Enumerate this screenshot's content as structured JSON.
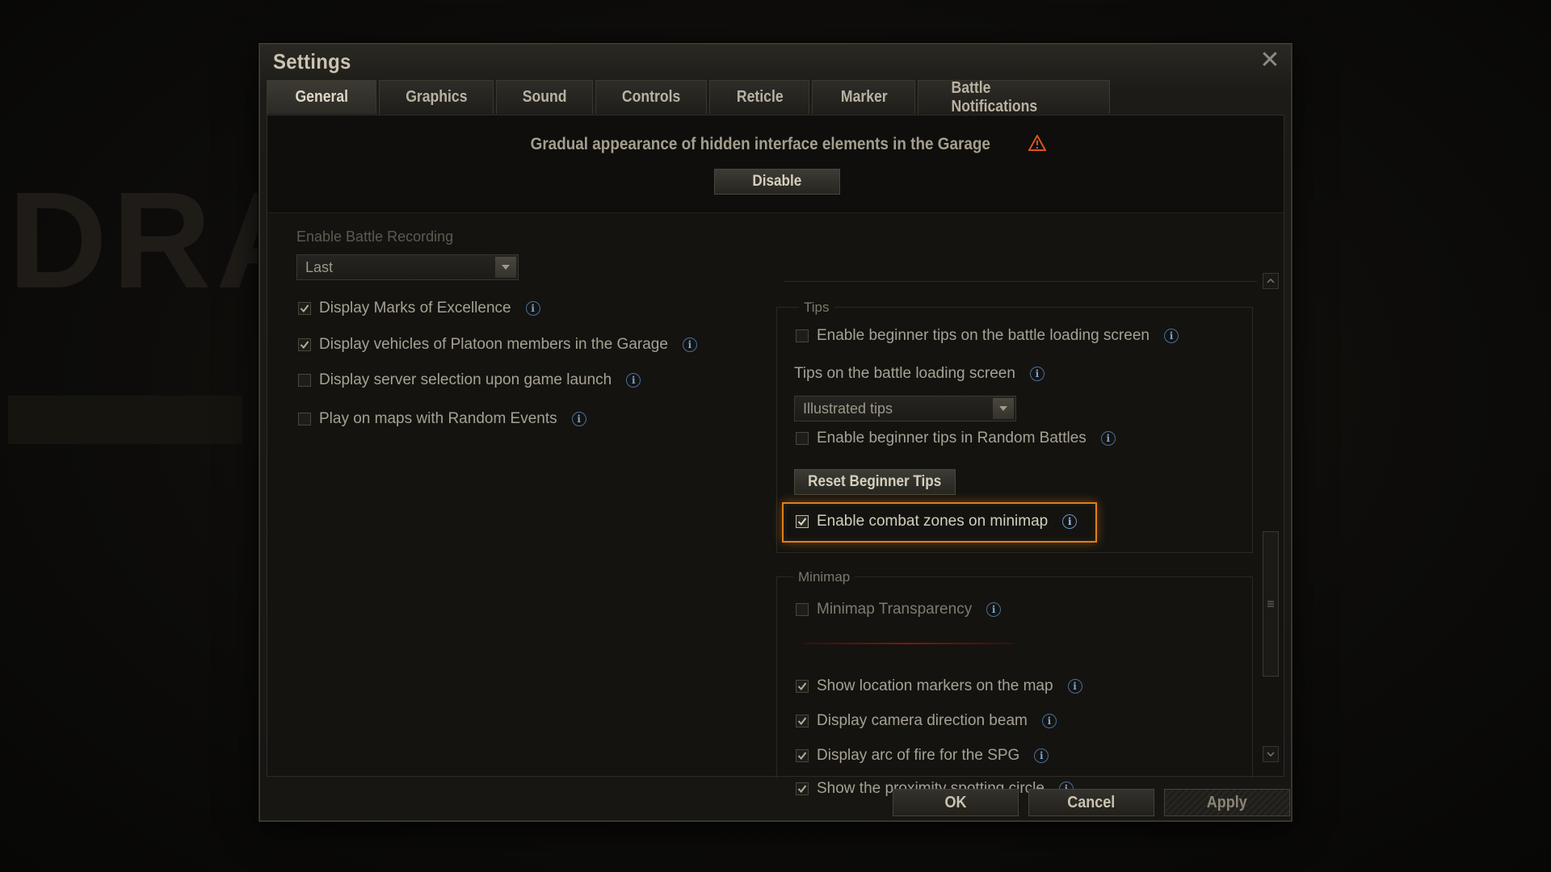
{
  "window": {
    "title": "Settings",
    "close_glyph": "✕"
  },
  "tabs": [
    {
      "label": "General",
      "active": true
    },
    {
      "label": "Graphics",
      "active": false
    },
    {
      "label": "Sound",
      "active": false
    },
    {
      "label": "Controls",
      "active": false
    },
    {
      "label": "Reticle",
      "active": false
    },
    {
      "label": "Marker",
      "active": false
    },
    {
      "label": "Battle Notifications",
      "active": false
    }
  ],
  "notice": {
    "text": "Gradual appearance of hidden interface elements in the Garage",
    "icon": "warning-icon",
    "button_label": "Disable"
  },
  "left": {
    "battle_recording_label": "Enable Battle Recording",
    "battle_recording_value": "Last",
    "options": [
      {
        "label": "Display Marks of Excellence",
        "checked": true
      },
      {
        "label": "Display vehicles of Platoon members in the Garage",
        "checked": true
      },
      {
        "label": "Display server selection upon game launch",
        "checked": false
      },
      {
        "label": "Play on maps with Random Events",
        "checked": false
      }
    ]
  },
  "tips": {
    "group_label": "Tips",
    "beginner_tips_loading": {
      "label": "Enable beginner tips on the battle loading screen",
      "checked": false
    },
    "tips_loading_label": "Tips on the battle loading screen",
    "tips_loading_value": "Illustrated tips",
    "beginner_tips_random": {
      "label": "Enable beginner tips in Random Battles",
      "checked": false
    },
    "reset_button_label": "Reset Beginner Tips",
    "combat_zones": {
      "label": "Enable combat zones on minimap",
      "checked": true
    }
  },
  "minimap": {
    "group_label": "Minimap",
    "transparency": {
      "label": "Minimap Transparency",
      "checked": false
    },
    "options": [
      {
        "label": "Show location markers on the map",
        "checked": true
      },
      {
        "label": "Display camera direction beam",
        "checked": true
      },
      {
        "label": "Display arc of fire for the SPG",
        "checked": true
      },
      {
        "label": "Show the proximity spotting circle",
        "checked": true
      }
    ]
  },
  "footer": {
    "ok_label": "OK",
    "cancel_label": "Cancel",
    "apply_label": "Apply"
  },
  "colors": {
    "highlight": "#e0801c",
    "info_icon": "#7aa6d4",
    "warning": "#d9541a"
  }
}
